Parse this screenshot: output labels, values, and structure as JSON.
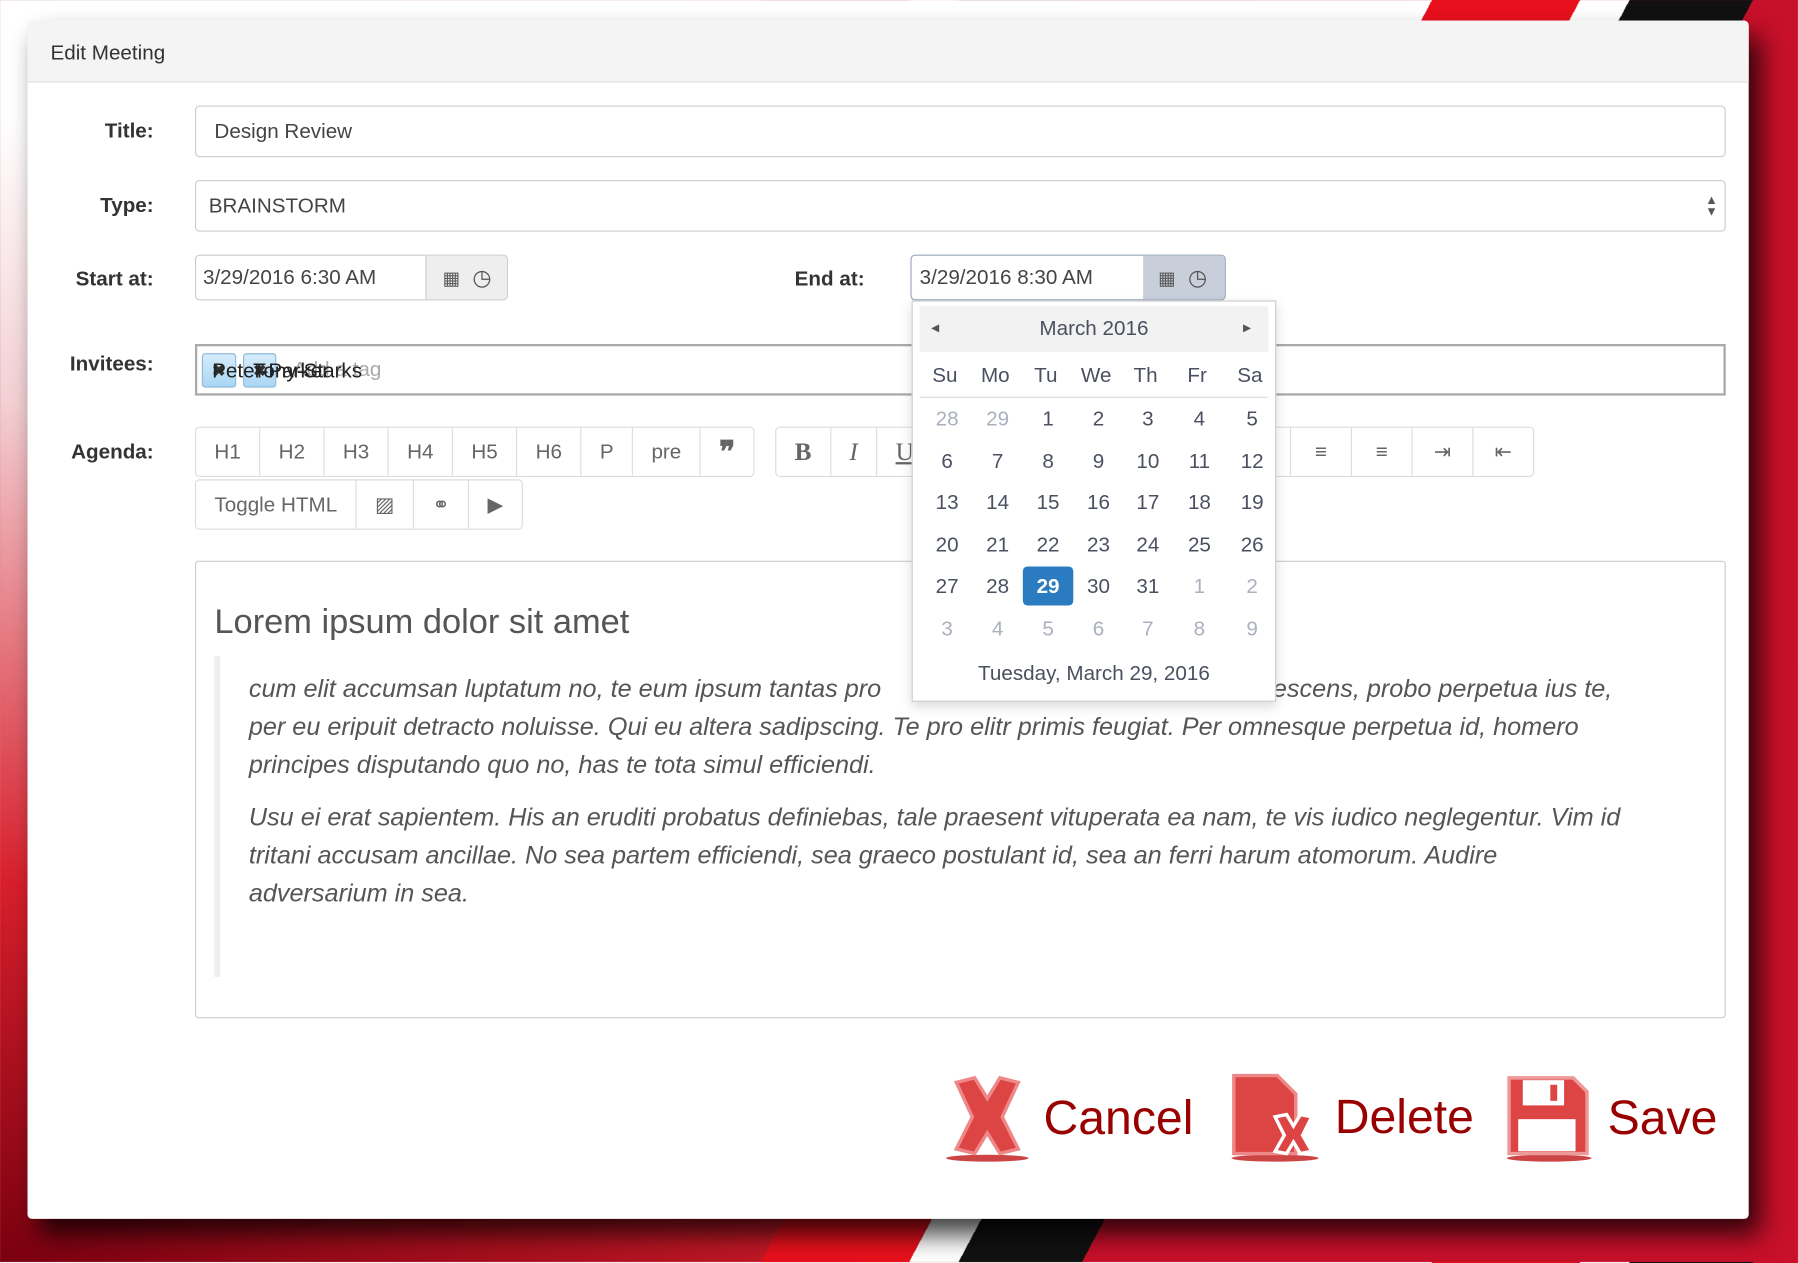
{
  "dialog": {
    "title": "Edit Meeting"
  },
  "form": {
    "title_label": "Title:",
    "title_value": "Design Review",
    "type_label": "Type:",
    "type_value": "BRAINSTORM",
    "start_label": "Start at:",
    "start_value": "3/29/2016 6:30 AM",
    "end_label": "End at:",
    "end_value": "3/29/2016 8:30 AM",
    "invitees_label": "Invitees:",
    "invitees": [
      "Peter-Parker",
      "Tony-Starks"
    ],
    "tag_placeholder": "Add a tag",
    "agenda_label": "Agenda:"
  },
  "toolbar": {
    "format": [
      "H1",
      "H2",
      "H3",
      "H4",
      "H5",
      "H6",
      "P",
      "pre",
      "❞"
    ],
    "style": [
      "B",
      "I",
      "U"
    ],
    "align_icons": [
      "align-center-icon",
      "align-right-icon",
      "indent-icon",
      "outdent-icon"
    ],
    "toggle_html": "Toggle HTML",
    "insert_icons": [
      "image-icon",
      "link-icon",
      "video-icon"
    ]
  },
  "editor": {
    "heading": "Lorem ipsum dolor sit amet",
    "p1_line1_a": "cum elit accumsan luptatum no, te eum ipsum tantas pro",
    "p1_line1_b": "adolescens, probo perpetua ius te,",
    "p1_line2": "per eu eripuit detracto noluisse. Qui eu altera sadipscing. Te pro elitr primis feugiat. Per omnesque perpetua id, homero",
    "p1_line3": "principes disputando quo no, has te tota simul efficiendi.",
    "p2_line1": "Usu ei erat sapientem. His an eruditi probatus definiebas, tale praesent vituperata ea nam, te vis iudico neglegentur. Vim id",
    "p2_line2": "tritani accusam ancillae. No sea partem efficiendi, sea graeco postulant id, sea an ferri harum atomorum. Audire",
    "p2_line3": "adversarium in sea."
  },
  "calendar": {
    "month": "March 2016",
    "prev": "◂",
    "next": "▸",
    "weekdays": [
      "Su",
      "Mo",
      "Tu",
      "We",
      "Th",
      "Fr",
      "Sa"
    ],
    "weeks": [
      [
        "28",
        "29",
        "1",
        "2",
        "3",
        "4",
        "5"
      ],
      [
        "6",
        "7",
        "8",
        "9",
        "10",
        "11",
        "12"
      ],
      [
        "13",
        "14",
        "15",
        "16",
        "17",
        "18",
        "19"
      ],
      [
        "20",
        "21",
        "22",
        "23",
        "24",
        "25",
        "26"
      ],
      [
        "27",
        "28",
        "29",
        "30",
        "31",
        "1",
        "2"
      ],
      [
        "3",
        "4",
        "5",
        "6",
        "7",
        "8",
        "9"
      ]
    ],
    "selected": "29",
    "footer": "Tuesday, March 29, 2016"
  },
  "actions": {
    "cancel": "Cancel",
    "delete": "Delete",
    "save": "Save"
  },
  "colors": {
    "accent": "#2a7bbf",
    "action_text": "#990000",
    "tag_bg": "#bfe1f8"
  }
}
